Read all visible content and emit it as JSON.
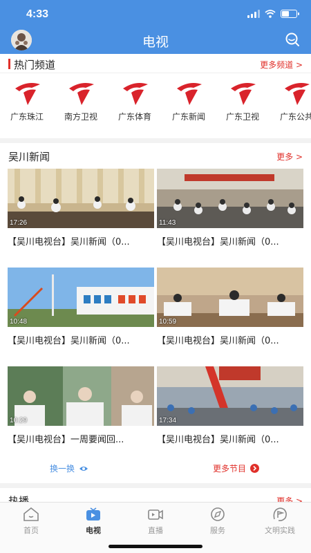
{
  "status": {
    "time": "4:33"
  },
  "header": {
    "title": "电视"
  },
  "hot_channels": {
    "title": "热门频道",
    "more": "更多频道 >",
    "items": [
      "广东珠江",
      "南方卫视",
      "广东体育",
      "广东新闻",
      "广东卫视",
      "广东公共"
    ]
  },
  "news": {
    "title": "吴川新闻",
    "more": "更多 >",
    "items": [
      {
        "duration": "17:26",
        "title": "【吴川电视台】吴川新闻（0..."
      },
      {
        "duration": "11:43",
        "title": "【吴川电视台】吴川新闻（0..."
      },
      {
        "duration": "10:48",
        "title": "【吴川电视台】吴川新闻（0..."
      },
      {
        "duration": "10:59",
        "title": "【吴川电视台】吴川新闻（0..."
      },
      {
        "duration": "10:29",
        "title": "【吴川电视台】一周要闻回..."
      },
      {
        "duration": "17:34",
        "title": "【吴川电视台】吴川新闻（0..."
      }
    ],
    "swap": "换一换",
    "more_programs": "更多节目"
  },
  "hot_play": {
    "title": "热播",
    "more": "更多 >"
  },
  "tabs": [
    "首页",
    "电视",
    "直播",
    "服务",
    "文明实践"
  ],
  "colors": {
    "primary": "#4a90e2",
    "accent": "#e0302a"
  }
}
